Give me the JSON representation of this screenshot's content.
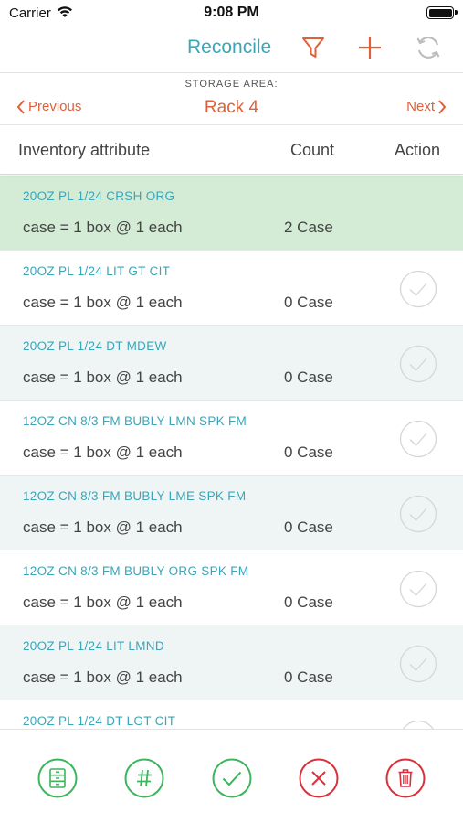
{
  "status_bar": {
    "carrier": "Carrier",
    "time": "9:08 PM"
  },
  "nav": {
    "title": "Reconcile",
    "filter_icon": "filter-icon",
    "add_icon": "plus-icon",
    "refresh_icon": "refresh-icon"
  },
  "storage": {
    "label": "STORAGE AREA:",
    "previous": "Previous",
    "rack": "Rack 4",
    "next": "Next"
  },
  "columns": {
    "attribute": "Inventory attribute",
    "count": "Count",
    "action": "Action"
  },
  "items": [
    {
      "name": "20OZ PL 1/24 CRSH ORG",
      "unit": "case = 1 box @ 1 each",
      "count": "2 Case",
      "selected": true
    },
    {
      "name": "20OZ PL 1/24 LIT GT CIT",
      "unit": "case = 1 box @ 1 each",
      "count": "0 Case",
      "selected": false
    },
    {
      "name": "20OZ PL 1/24 DT MDEW",
      "unit": "case = 1 box @ 1 each",
      "count": "0 Case",
      "selected": false
    },
    {
      "name": "12OZ CN 8/3 FM BUBLY LMN SPK FM",
      "unit": "case = 1 box @ 1 each",
      "count": "0 Case",
      "selected": false
    },
    {
      "name": "12OZ CN 8/3 FM BUBLY LME SPK FM",
      "unit": "case = 1 box @ 1 each",
      "count": "0 Case",
      "selected": false
    },
    {
      "name": "12OZ CN 8/3 FM BUBLY ORG SPK FM",
      "unit": "case = 1 box @ 1 each",
      "count": "0 Case",
      "selected": false
    },
    {
      "name": "20OZ PL 1/24 LIT LMND",
      "unit": "case = 1 box @ 1 each",
      "count": "0 Case",
      "selected": false
    },
    {
      "name": "20OZ PL 1/24 DT LGT CIT",
      "unit": "",
      "count": "",
      "selected": false
    }
  ],
  "toolbar": [
    "storage-icon",
    "number-icon",
    "checkmark-icon",
    "cancel-icon",
    "trash-icon"
  ],
  "colors": {
    "teal": "#3aa6b9",
    "orange": "#e0603a",
    "green": "#3cb55c",
    "red": "#d9303c",
    "selected_row": "#d4ecd6",
    "alt_row": "#eff5f5"
  }
}
